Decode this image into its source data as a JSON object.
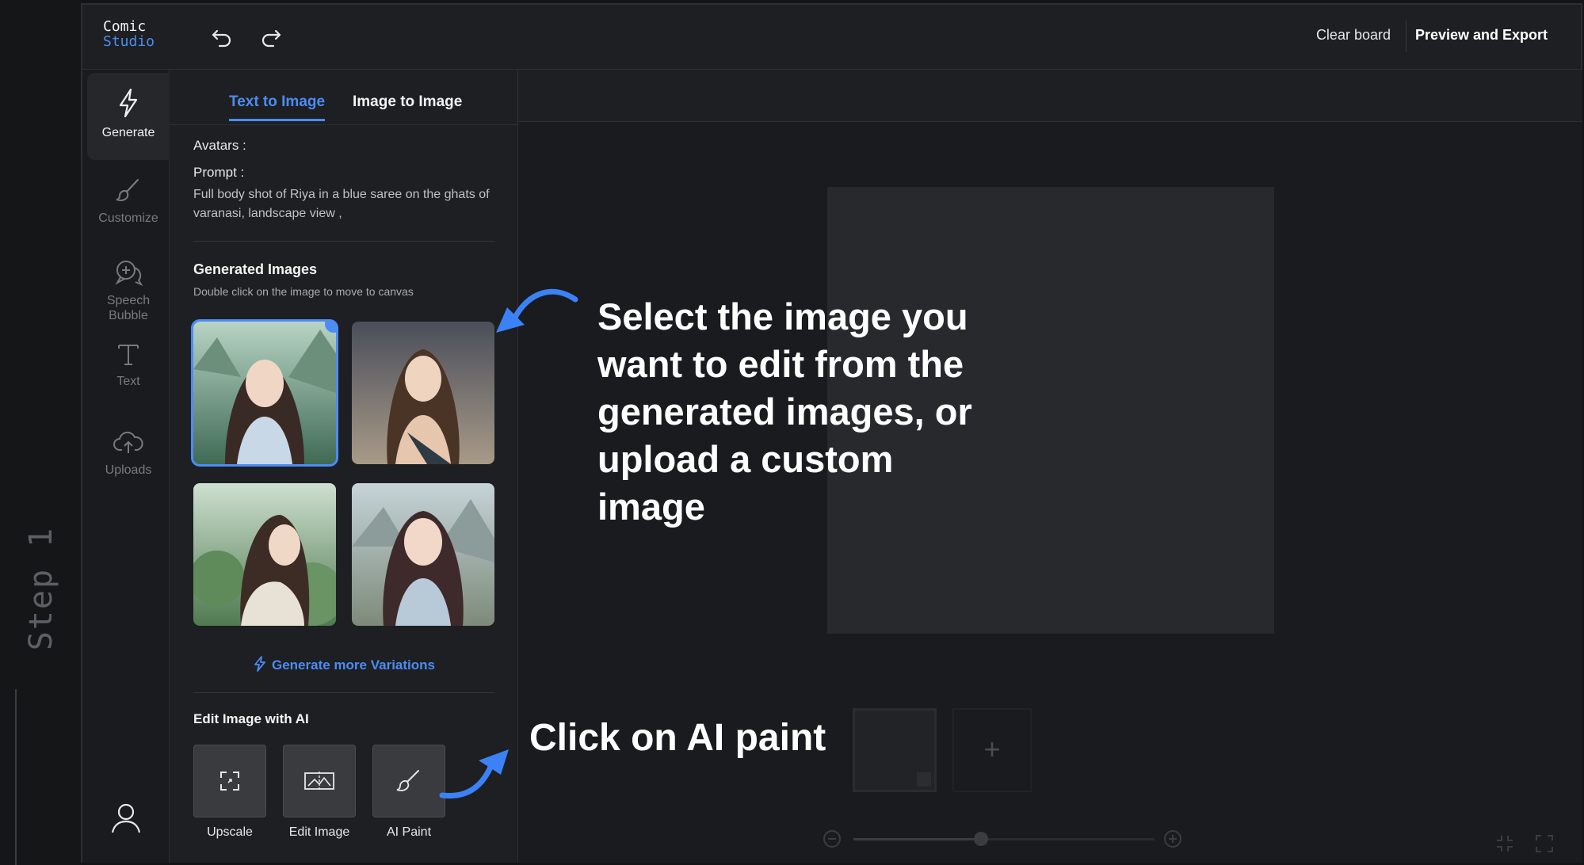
{
  "step_label": "Step 1",
  "app": {
    "logo_line1": "Comic",
    "logo_line2": "Studio",
    "clear_board": "Clear board",
    "preview_export": "Preview and Export"
  },
  "nav": {
    "items": [
      {
        "label": "Generate",
        "icon": "lightning-icon"
      },
      {
        "label": "Customize",
        "icon": "brush-icon"
      },
      {
        "label": "Speech Bubble",
        "icon": "speech-bubble-icon"
      },
      {
        "label": "Text",
        "icon": "text-icon"
      },
      {
        "label": "Uploads",
        "icon": "upload-cloud-icon"
      }
    ]
  },
  "panel": {
    "tabs": [
      "Text to Image",
      "Image to Image"
    ],
    "avatars_label": "Avatars :",
    "prompt_label": "Prompt :",
    "prompt_text": "Full body shot of Riya in a blue saree on the ghats of varanasi, landscape view ,",
    "generated_title": "Generated Images",
    "generated_sub": "Double click on the image to move to canvas",
    "generate_more": "Generate more Variations",
    "edit_title": "Edit Image with AI",
    "tools": [
      {
        "label": "Upscale",
        "icon": "upscale-icon"
      },
      {
        "label": "Edit Image",
        "icon": "edit-image-icon"
      },
      {
        "label": "AI Paint",
        "icon": "paint-brush-icon"
      }
    ]
  },
  "overlay": {
    "callout_1": "Select the image you want to edit from the generated images, or upload a custom image",
    "callout_2": "Click on AI paint"
  },
  "colors": {
    "accent": "#4b8cf5",
    "background": "#1e1f22",
    "canvas": "#28292c"
  }
}
